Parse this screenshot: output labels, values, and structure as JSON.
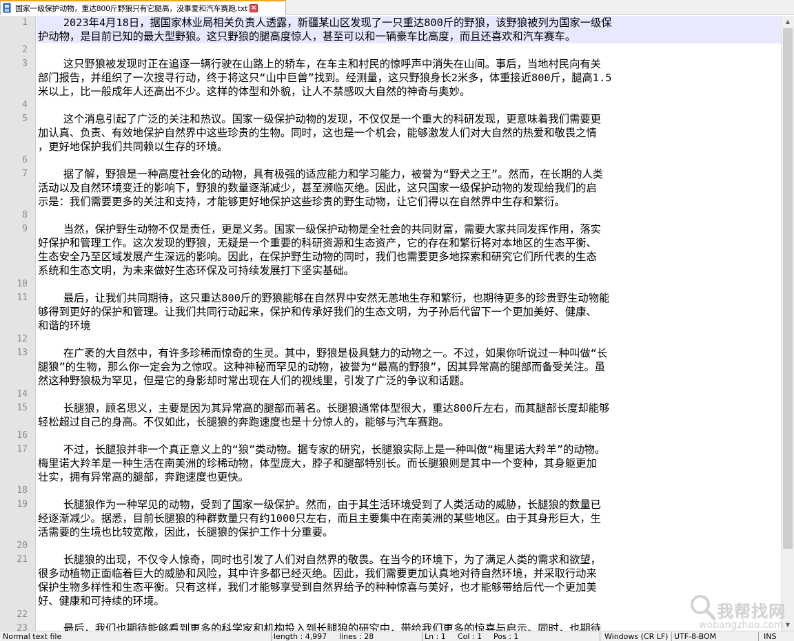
{
  "tab": {
    "title": "国家一级保护动物，重达800斤野狼只有它腿高，没事爱和汽车赛跑.txt",
    "close_glyph": "×"
  },
  "editor": {
    "current_line": 1,
    "lines": [
      {
        "n": "1",
        "t": "    2023年4月18日，据国家林业局相关负责人透露，新疆某山区发现了一只重达800斤的野狼，该野狼被列为国家一级保"
      },
      {
        "n": "",
        "t": "护动物，是目前已知的最大型野狼。这只野狼的腿高度惊人，甚至可以和一辆豪车比高度，而且还喜欢和汽车赛车。"
      },
      {
        "n": "2",
        "t": ""
      },
      {
        "n": "3",
        "t": "    这只野狼被发现时正在追逐一辆行驶在山路上的轿车，在车主和村民的惊呼声中消失在山间。事后，当地村民向有关"
      },
      {
        "n": "",
        "t": "部门报告，并组织了一次搜寻行动，终于将这只“山中巨兽”找到。经测量，这只野狼身长2米多，体重接近800斤，腿高1.5"
      },
      {
        "n": "",
        "t": "米以上，比一般成年人还高出不少。这样的体型和外貌，让人不禁感叹大自然的神奇与奥妙。"
      },
      {
        "n": "4",
        "t": ""
      },
      {
        "n": "5",
        "t": "    这个消息引起了广泛的关注和热议。国家一级保护动物的发现，不仅仅是一个重大的科研发现，更意味着我们需要更"
      },
      {
        "n": "",
        "t": "加认真、负责、有效地保护自然界中这些珍贵的生物。同时，这也是一个机会，能够激发人们对大自然的热爱和敬畏之情"
      },
      {
        "n": "",
        "t": "，更好地保护我们共同赖以生存的环境。"
      },
      {
        "n": "6",
        "t": ""
      },
      {
        "n": "7",
        "t": "    据了解，野狼是一种高度社会化的动物，具有极强的适应能力和学习能力，被誉为“野犬之王”。然而，在长期的人类"
      },
      {
        "n": "",
        "t": "活动以及自然环境变迁的影响下，野狼的数量逐渐减少，甚至濒临灭绝。因此，这只国家一级保护动物的发现给我们的启"
      },
      {
        "n": "",
        "t": "示是：我们需要更多的关注和支持，才能够更好地保护这些珍贵的野生动物，让它们得以在自然界中生存和繁衍。"
      },
      {
        "n": "8",
        "t": ""
      },
      {
        "n": "9",
        "t": "    当然，保护野生动物不仅是责任，更是义务。国家一级保护动物是全社会的共同财富，需要大家共同发挥作用，落实"
      },
      {
        "n": "",
        "t": "好保护和管理工作。这次发现的野狼，无疑是一个重要的科研资源和生态资产，它的存在和繁衍将对本地区的生态平衡、"
      },
      {
        "n": "",
        "t": "生态安全乃至区域发展产生深远的影响。因此，在保护野生动物的同时，我们也需要更多地探索和研究它们所代表的生态"
      },
      {
        "n": "",
        "t": "系统和生态文明，为未来做好生态环保及可持续发展打下坚实基础。"
      },
      {
        "n": "10",
        "t": ""
      },
      {
        "n": "11",
        "t": "    最后，让我们共同期待，这只重达800斤的野狼能够在自然界中安然无恙地生存和繁衍，也期待更多的珍贵野生动物能"
      },
      {
        "n": "",
        "t": "够得到更好的保护和管理。让我们共同行动起来，保护和传承好我们的生态文明，为子孙后代留下一个更加美好、健康、"
      },
      {
        "n": "",
        "t": "和谐的环境"
      },
      {
        "n": "12",
        "t": ""
      },
      {
        "n": "13",
        "t": "    在广袤的大自然中，有许多珍稀而惊奇的生灵。其中，野狼是极具魅力的动物之一。不过，如果你听说过一种叫做“长"
      },
      {
        "n": "",
        "t": "腿狼”的生物，那么你一定会为之惊叹。这种神秘而罕见的动物，被誉为“最高的野狼”，因其异常高的腿部而备受关注。虽"
      },
      {
        "n": "",
        "t": "然这种野狼极为罕见，但是它的身影却时常出现在人们的视线里，引发了广泛的争议和话题。"
      },
      {
        "n": "14",
        "t": ""
      },
      {
        "n": "15",
        "t": "    长腿狼，顾名思义，主要是因为其异常高的腿部而著名。长腿狼通常体型很大，重达800斤左右，而其腿部长度却能够"
      },
      {
        "n": "",
        "t": "轻松超过自己的身高。不仅如此，长腿狼的奔跑速度也是十分惊人的，能够与汽车赛跑。"
      },
      {
        "n": "16",
        "t": ""
      },
      {
        "n": "17",
        "t": "    不过，长腿狼并非一个真正意义上的“狼”类动物。据专家的研究，长腿狼实际上是一种叫做“梅里诺大羚羊”的动物。"
      },
      {
        "n": "",
        "t": "梅里诺大羚羊是一种生活在南美洲的珍稀动物，体型庞大，脖子和腿部特别长。而长腿狼则是其中一个变种，其身躯更加"
      },
      {
        "n": "",
        "t": "壮实，拥有异常高的腿部，奔跑速度也更快。"
      },
      {
        "n": "18",
        "t": ""
      },
      {
        "n": "19",
        "t": "    长腿狼作为一种罕见的动物，受到了国家一级保护。然而，由于其生活环境受到了人类活动的威胁，长腿狼的数量已"
      },
      {
        "n": "",
        "t": "经逐渐减少。据悉，目前长腿狼的种群数量只有约1000只左右，而且主要集中在南美洲的某些地区。由于其身形巨大，生"
      },
      {
        "n": "",
        "t": "活需要的生境也比较宽敞，因此，长腿狼的保护工作十分重要。"
      },
      {
        "n": "20",
        "t": ""
      },
      {
        "n": "21",
        "t": "    长腿狼的出现，不仅令人惊奇，同时也引发了人们对自然界的敬畏。在当今的环境下，为了满足人类的需求和欲望，"
      },
      {
        "n": "",
        "t": "很多动植物正面临着巨大的威胁和风险，其中许多都已经灭绝。因此，我们需要更加认真地对待自然环境，并采取行动来"
      },
      {
        "n": "",
        "t": "保护生物多样性和生态平衡。只有这样，我们才能够享受到自然界给予的种种惊喜与美好，也才能够带给后代一个更加美"
      },
      {
        "n": "",
        "t": "好、健康和可持续的环境。"
      },
      {
        "n": "22",
        "t": ""
      },
      {
        "n": "23",
        "t": "    最后，我们也期待能够看到更多的科学家和机构投入到长腿狼的研究中，带给我们更多的惊喜与启示。同时，也期待"
      }
    ]
  },
  "statusbar": {
    "file_type": "Normal text file",
    "length": "length : 4,997",
    "lines": "lines : 28",
    "ln": "Ln : 1",
    "col": "Col : 1",
    "pos": "Pos : 1",
    "eol": "Windows (CR LF)",
    "encoding": "UTF-8-BOM",
    "mode": "INS"
  },
  "watermark": {
    "text": "我帮找网",
    "url": "wobangzhao.com"
  },
  "colors": {
    "tab_accent": "#f7a21b",
    "current_line_bg": "#e8e8ff",
    "gutter_bg": "#e4e4e4",
    "line_number": "#8a8a8a"
  }
}
